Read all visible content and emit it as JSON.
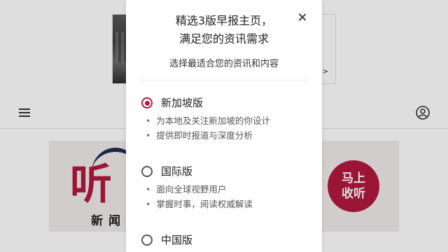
{
  "background": {
    "ad_arrow": ">",
    "banner": {
      "logo_text": "听",
      "subtitle": "新闻",
      "cta_line1": "马上",
      "cta_line2": "收听",
      "brand_color": "#b3193f"
    }
  },
  "modal": {
    "title_line1": "精选3版早报主页，",
    "title_line2": "满足您的资讯需求",
    "subtitle": "选择最适合您的资讯和内容",
    "close_icon": "close-icon",
    "options": [
      {
        "label": "新加坡版",
        "selected": true,
        "bullets": [
          "为本地及关注新加坡的你设计",
          "提供即时报道与深度分析"
        ]
      },
      {
        "label": "国际版",
        "selected": false,
        "bullets": [
          "面向全球视野用户",
          "掌握时事，阅读权威解读"
        ]
      },
      {
        "label": "中国版",
        "selected": false,
        "bullets": []
      }
    ]
  }
}
